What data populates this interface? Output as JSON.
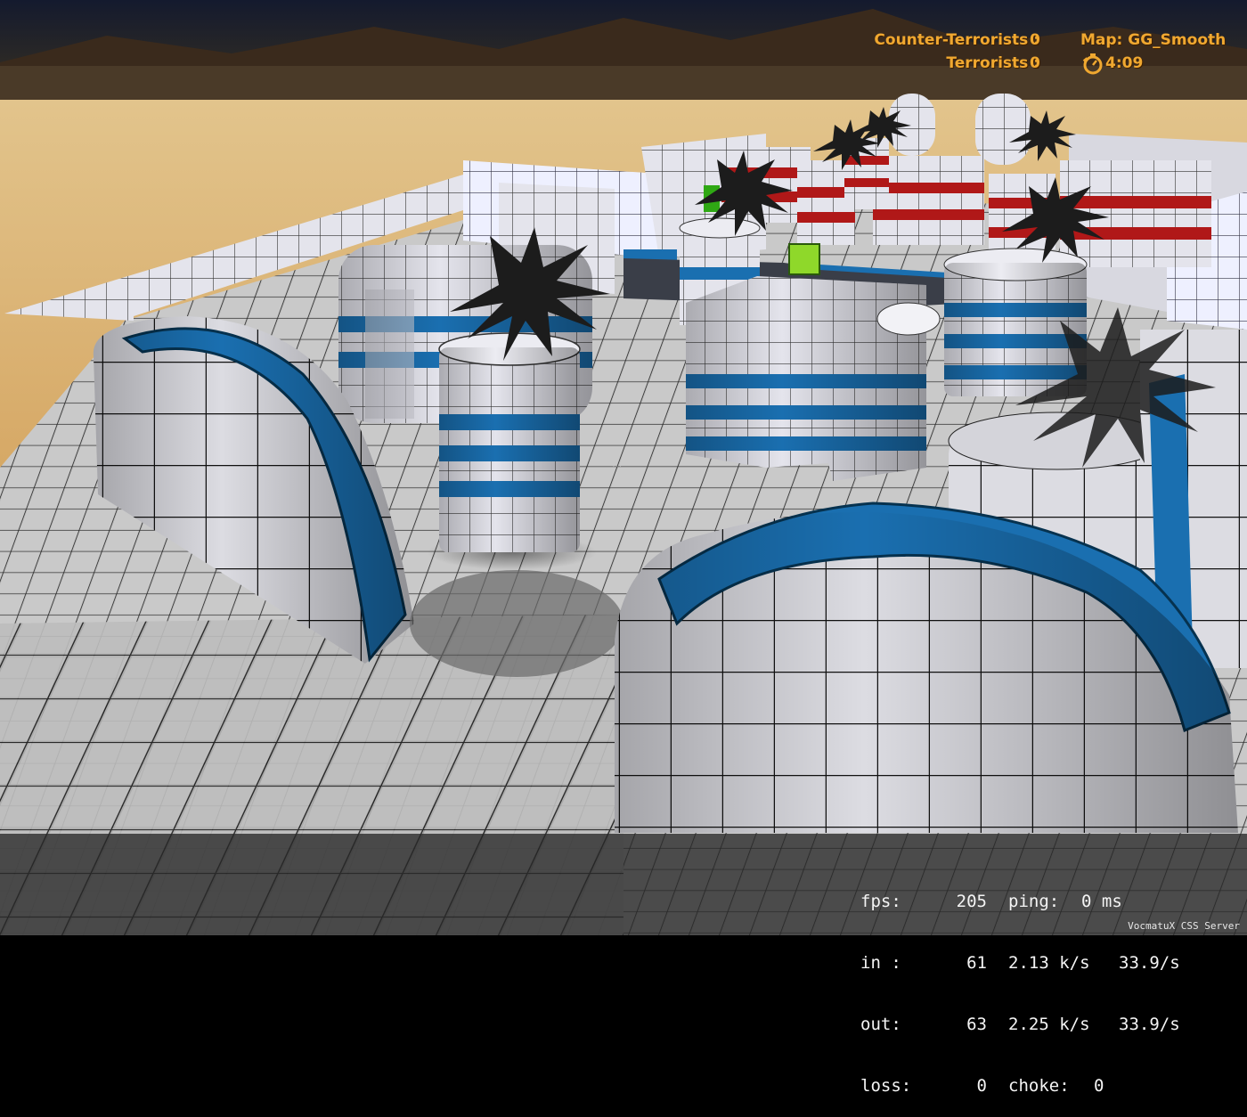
{
  "hud": {
    "ct_label": "Counter-Terrorists :",
    "ct_score": "0",
    "t_label": "Terrorists :",
    "t_score": "0",
    "map_label": "Map: GG_Smooth",
    "timer": "4:09",
    "timer_icon": "stopwatch-icon",
    "accent_color": "#f0a830"
  },
  "netgraph": {
    "rows": [
      {
        "a": "fps:",
        "b": "205",
        "c": "ping:",
        "d": "0 ms",
        "e": ""
      },
      {
        "a": "in :",
        "b": "61",
        "c": "2.13 k/s",
        "d": "",
        "e": "33.9/s"
      },
      {
        "a": "out:",
        "b": "63",
        "c": "2.25 k/s",
        "d": "",
        "e": "33.9/s"
      },
      {
        "a": "loss:",
        "b": "0",
        "c": "choke:",
        "d": "0",
        "e": ""
      }
    ]
  },
  "server": {
    "name": "VocmatuX CSS Server"
  }
}
